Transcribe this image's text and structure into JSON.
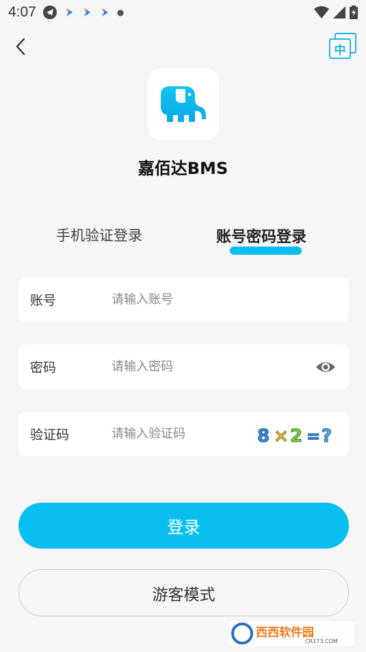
{
  "status_bar": {
    "time": "4:07",
    "icons": [
      "telegram-icon",
      "app-notification-icon",
      "app-notification-icon",
      "app-notification-icon",
      "more-dot-icon",
      "wifi-icon",
      "signal-icon",
      "battery-icon"
    ]
  },
  "header": {
    "back_icon": "chevron-left-icon",
    "language_label": "中"
  },
  "app": {
    "name": "嘉佰达BMS",
    "logo_icon": "elephant-icon"
  },
  "tabs": [
    {
      "label": "手机验证登录",
      "active": false
    },
    {
      "label": "账号密码登录",
      "active": true
    }
  ],
  "form": {
    "account": {
      "label": "账号",
      "placeholder": "请输入账号",
      "value": ""
    },
    "password": {
      "label": "密码",
      "placeholder": "请输入密码",
      "value": "",
      "toggle_icon": "eye-icon"
    },
    "captcha": {
      "label": "验证码",
      "placeholder": "请输入验证码",
      "value": "",
      "image_text": "8×2=?"
    }
  },
  "buttons": {
    "login": "登录",
    "guest": "游客模式"
  },
  "watermark": {
    "text_main": "西西软件园",
    "text_sub": "CR173.COM"
  },
  "colors": {
    "accent": "#08bff0",
    "background": "#f6f6f6",
    "field_bg": "#ffffff"
  }
}
